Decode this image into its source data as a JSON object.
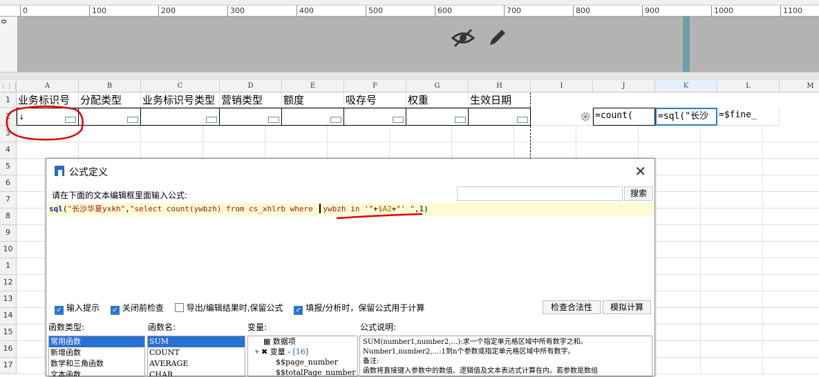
{
  "ruler": {
    "ticks": [
      "0",
      "100",
      "200",
      "300",
      "400",
      "500",
      "600",
      "700",
      "800",
      "900",
      "1000",
      "1100"
    ],
    "vertical_label": "0"
  },
  "columns": [
    "A",
    "B",
    "C",
    "D",
    "E",
    "F",
    "G",
    "H",
    "I",
    "J",
    "K",
    "L",
    "M"
  ],
  "rows": [
    "1",
    "2",
    "3",
    "4",
    "5",
    "6",
    "7",
    "8",
    "9",
    "10",
    "1",
    "12",
    "13",
    "14",
    "15",
    "16",
    "17"
  ],
  "header_row": [
    "业务标识号",
    "分配类型",
    "业务标识号类型",
    "营销类型",
    "额度",
    "吸存号",
    "权重",
    "生效日期"
  ],
  "row2": {
    "a": "↓",
    "j": "=count(",
    "k": "=sql(\"长沙",
    "l": "=$fine_"
  },
  "dialog": {
    "title": "公式定义",
    "close": "✕",
    "prompt": "请在下面的文本编辑框里面输入公式:",
    "search_button": "搜索",
    "formula": {
      "fn": "sql",
      "p1": "(",
      "s1": "\"长沙华夏yxkh\"",
      "p2": ",",
      "s2": "\"select count(ywbzh) from cs_xhlrb where ",
      "s3": "ywbzh in '\"",
      "plus1": "+",
      "var": "$A2",
      "plus2": "+",
      "s4": "\"' \"",
      "tail": ",1)"
    },
    "options": [
      {
        "label": "输入提示",
        "checked": true
      },
      {
        "label": "关闭前检查",
        "checked": true
      },
      {
        "label": "导出/编辑结果时,保留公式",
        "checked": false
      },
      {
        "label": "填报/分析时，保留公式用于计算",
        "checked": true
      }
    ],
    "check_button": "检查合法性",
    "simulate_button": "模拟计算",
    "fn_type_label": "函数类型:",
    "fn_types": [
      "常用函数",
      "新增函数",
      "数学和三角函数",
      "文本函数"
    ],
    "fn_name_label": "函数名:",
    "fn_names": [
      "SUM",
      "COUNT",
      "AVERAGE",
      "CHAR"
    ],
    "var_label": "变量:",
    "vars": {
      "data_item": "数据项",
      "var_group": "变量",
      "var_count": "[16]",
      "items": [
        "$$page_number",
        "$$totalPage_number"
      ]
    },
    "desc_label": "公式说明:",
    "desc_lines": [
      "SUM(number1,number2,…):求一个指定单元格区域中所有数字之和。",
      "Number1,number2,…:1到n个参数或指定单元格区域中所有数字。",
      "备注:",
      "函数将直接键入参数中的数值、逻辑值及文本表达式计算在内。若参数是数组"
    ]
  }
}
